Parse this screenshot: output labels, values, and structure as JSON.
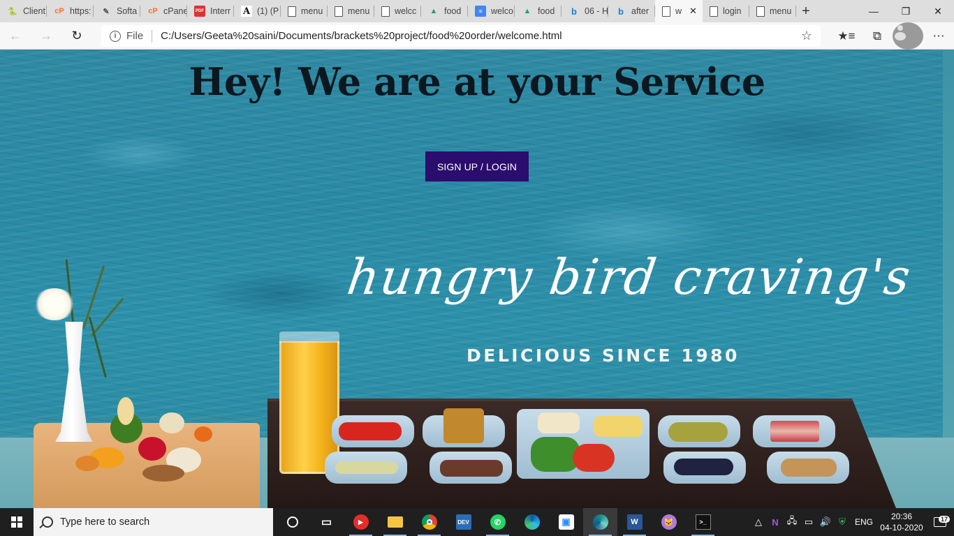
{
  "browser": {
    "tabs": [
      {
        "label": "Client",
        "icon": "php-icon"
      },
      {
        "label": "https:",
        "icon": "cpanel-icon"
      },
      {
        "label": "Softa",
        "icon": "pen-icon"
      },
      {
        "label": "cPane",
        "icon": "cpanel-icon"
      },
      {
        "label": "Interr",
        "icon": "pdf-icon"
      },
      {
        "label": "(1) (P",
        "icon": "font-a-icon"
      },
      {
        "label": "menu",
        "icon": "document-icon"
      },
      {
        "label": "menu",
        "icon": "document-icon"
      },
      {
        "label": "welcc",
        "icon": "document-icon"
      },
      {
        "label": "food",
        "icon": "google-drive-icon"
      },
      {
        "label": "welco",
        "icon": "google-docs-icon"
      },
      {
        "label": "food",
        "icon": "google-drive-icon"
      },
      {
        "label": "06 - H",
        "icon": "bing-icon"
      },
      {
        "label": "after",
        "icon": "bing-icon"
      },
      {
        "label": "w",
        "icon": "document-icon",
        "active": true
      },
      {
        "label": "login",
        "icon": "document-icon"
      },
      {
        "label": "menu",
        "icon": "document-icon"
      }
    ],
    "new_tab": "+",
    "address": {
      "scheme": "File",
      "url": "C:/Users/Geeta%20saini/Documents/brackets%20project/food%20order/welcome.html"
    }
  },
  "page": {
    "heading": "Hey! We are at your Service",
    "signup_button": "SIGN UP / LOGIN",
    "script_title": "hungry bird craving's",
    "subtitle": "DELICIOUS SINCE 1980"
  },
  "taskbar": {
    "search_placeholder": "Type here to search",
    "language": "ENG",
    "time": "20:36",
    "date": "04-10-2020",
    "notification_count": "17",
    "apps": [
      "cortana-icon",
      "task-view-icon",
      "youtube-music-icon",
      "file-explorer-icon",
      "chrome-icon",
      "dev-icon",
      "whatsapp-icon",
      "edge-icon",
      "zoom-icon",
      "edge-dev-icon",
      "word-icon",
      "cat-app-icon",
      "terminal-icon"
    ]
  },
  "colors": {
    "signup_button_bg": "#2b0d6e",
    "heading_color": "#0b1820",
    "water": "#2a8aa6"
  }
}
